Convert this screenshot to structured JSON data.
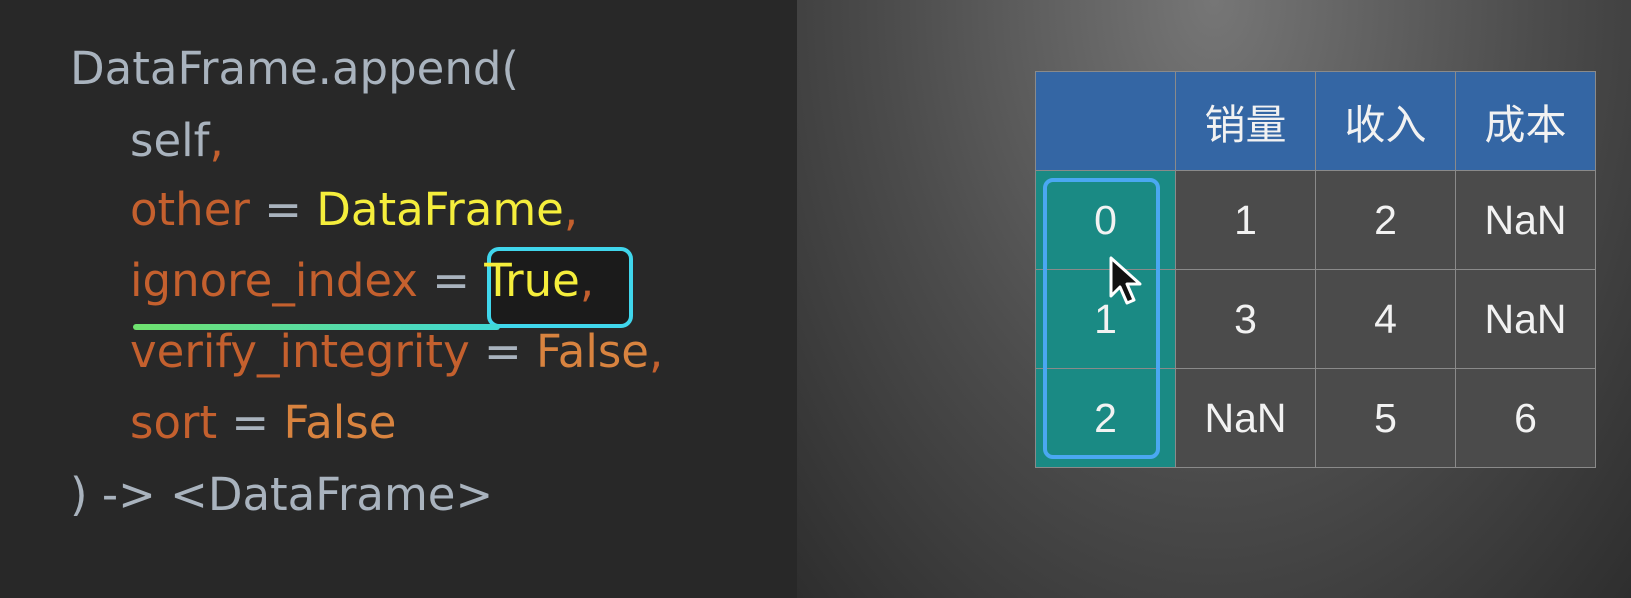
{
  "code": {
    "line1": "DataFrame.append(",
    "self_param": "self",
    "comma": ",",
    "other_param": "other",
    "eq": " = ",
    "other_value": "DataFrame",
    "ignore_param": "ignore_index",
    "ignore_value": "True",
    "verify_param": "verify_integrity",
    "verify_value": "False",
    "sort_param": "sort",
    "sort_value": "False",
    "closing": ") -> <DataFrame>"
  },
  "table": {
    "headers": [
      "",
      "销量",
      "收入",
      "成本"
    ],
    "rows": [
      {
        "index": "0",
        "cells": [
          "1",
          "2",
          "NaN"
        ]
      },
      {
        "index": "1",
        "cells": [
          "3",
          "4",
          "NaN"
        ]
      },
      {
        "index": "2",
        "cells": [
          "NaN",
          "5",
          "6"
        ]
      }
    ]
  },
  "colors": {
    "param": "#c4602e",
    "value_yellow": "#f5ee3c",
    "value_orange": "#d8833f",
    "header_bg": "#3466a4",
    "index_bg": "#1a8a84",
    "highlight_border": "#40d6ec"
  },
  "icons": {
    "cursor": "mouse-pointer-icon"
  }
}
